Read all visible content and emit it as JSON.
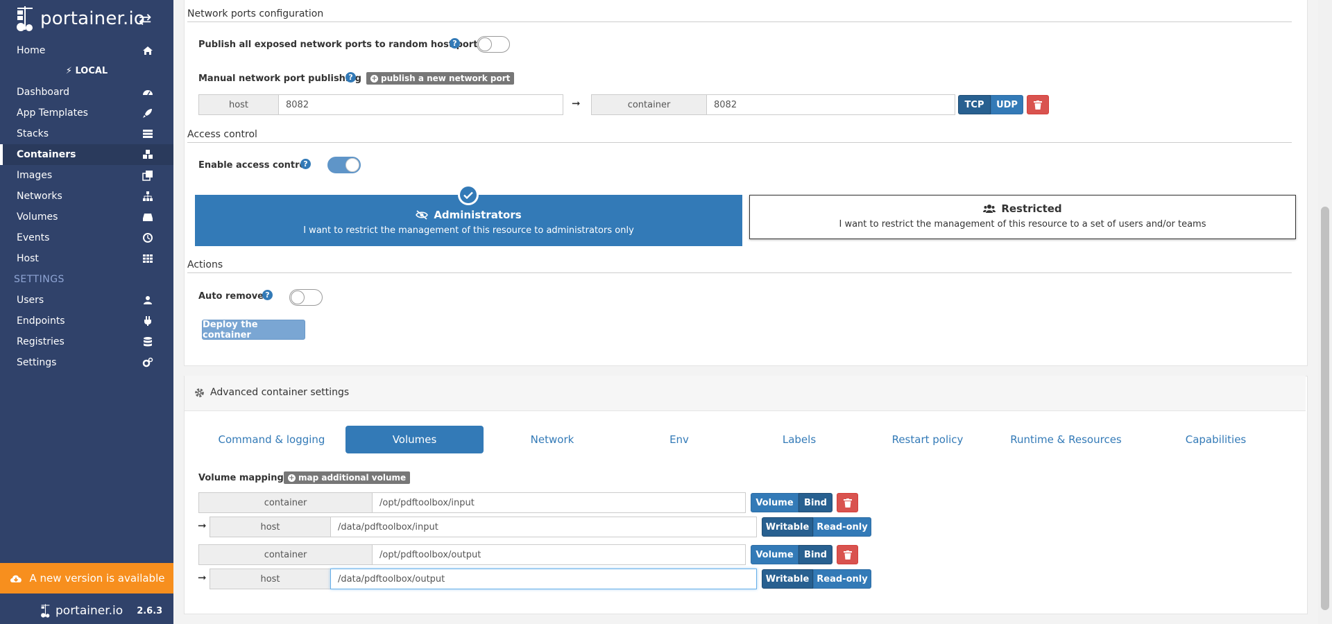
{
  "sidebar": {
    "brand": "portainer.io",
    "endpoint_label": "LOCAL",
    "items": [
      {
        "label": "Home",
        "icon": "home-icon"
      },
      {
        "label": "Dashboard",
        "icon": "dashboard-icon"
      },
      {
        "label": "App Templates",
        "icon": "rocket-icon"
      },
      {
        "label": "Stacks",
        "icon": "th-list-icon"
      },
      {
        "label": "Containers",
        "icon": "cubes-icon",
        "active": true
      },
      {
        "label": "Images",
        "icon": "clone-icon"
      },
      {
        "label": "Networks",
        "icon": "sitemap-icon"
      },
      {
        "label": "Volumes",
        "icon": "hdd-icon"
      },
      {
        "label": "Events",
        "icon": "history-icon"
      },
      {
        "label": "Host",
        "icon": "th-icon"
      }
    ],
    "settings_header": "SETTINGS",
    "settings_items": [
      {
        "label": "Users",
        "icon": "users-icon"
      },
      {
        "label": "Endpoints",
        "icon": "plug-icon"
      },
      {
        "label": "Registries",
        "icon": "database-icon"
      },
      {
        "label": "Settings",
        "icon": "cogs-icon"
      }
    ],
    "update_banner": "A new version is available",
    "footer_brand": "portainer.io",
    "version": "2.6.3"
  },
  "network_ports": {
    "section_title": "Network ports configuration",
    "publish_all_label": "Publish all exposed network ports to random host ports",
    "publish_all_enabled": false,
    "manual_label": "Manual network port publishing",
    "publish_new_button": "publish a new network port",
    "host_addon": "host",
    "host_value": "8082",
    "container_addon": "container",
    "container_value": "8082",
    "tcp_label": "TCP",
    "udp_label": "UDP"
  },
  "access_control": {
    "section_title": "Access control",
    "enable_label": "Enable access control",
    "enabled": true,
    "admin_title": "Administrators",
    "admin_desc": "I want to restrict the management of this resource to administrators only",
    "restricted_title": "Restricted",
    "restricted_desc": "I want to restrict the management of this resource to a set of users and/or teams"
  },
  "actions": {
    "section_title": "Actions",
    "auto_remove_label": "Auto remove",
    "auto_remove_enabled": false,
    "deploy_button": "Deploy the container"
  },
  "advanced": {
    "header": "Advanced container settings",
    "tabs": [
      "Command & logging",
      "Volumes",
      "Network",
      "Env",
      "Labels",
      "Restart policy",
      "Runtime & Resources",
      "Capabilities"
    ],
    "active_tab": "Volumes",
    "volume_mapping_label": "Volume mapping",
    "map_button": "map additional volume",
    "volumes": [
      {
        "container_addon": "container",
        "container_path": "/opt/pdftoolbox/input",
        "host_addon": "host",
        "host_path": "/data/pdftoolbox/input",
        "type_volume": "Volume",
        "type_bind": "Bind",
        "writable": "Writable",
        "readonly": "Read-only"
      },
      {
        "container_addon": "container",
        "container_path": "/opt/pdftoolbox/output",
        "host_addon": "host",
        "host_path": "/data/pdftoolbox/output",
        "type_volume": "Volume",
        "type_bind": "Bind",
        "writable": "Writable",
        "readonly": "Read-only"
      }
    ]
  },
  "colors": {
    "sidebar_bg": "#30426a",
    "primary": "#337ab7",
    "danger": "#d9534f",
    "warning": "#f78f1e"
  }
}
